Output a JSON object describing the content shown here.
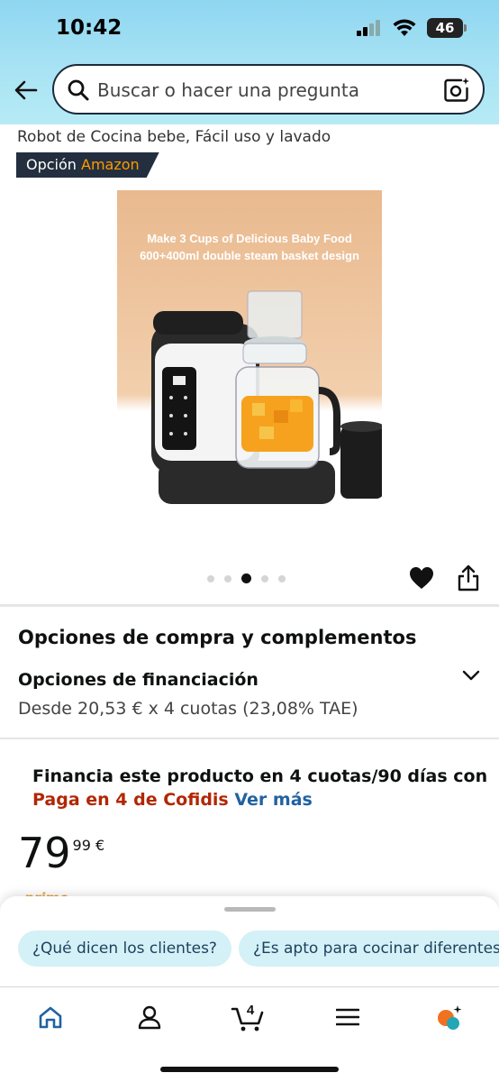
{
  "status_bar": {
    "time": "10:42",
    "battery": "46"
  },
  "search": {
    "placeholder": "Buscar o hacer una pregunta"
  },
  "product": {
    "title": "Robot de Cocina bebe, Fácil uso y lavado",
    "badge_prefix": "Opción",
    "badge_accent": "Amazon",
    "image_caption_line1": "Make 3 Cups of Delicious Baby Food",
    "image_caption_line2": "600+400ml double steam basket design",
    "image_count": 5,
    "image_active_index": 2
  },
  "purchase": {
    "heading": "Opciones de compra y complementos",
    "financing_title": "Opciones de financiación",
    "financing_subtitle": "Desde 20,53 € x 4 cuotas (23,08% TAE)"
  },
  "cofidis": {
    "line1": "Financia este producto en 4 cuotas/90 días con",
    "red_text": "Paga en 4 de Cofidis",
    "link_text": "Ver más"
  },
  "price": {
    "whole": "79",
    "fraction": "99 €",
    "prime_peek": "prime"
  },
  "sheet": {
    "chips": [
      "¿Qué dicen los clientes?",
      "¿Es apto para cocinar diferentes alimentos?"
    ]
  },
  "tabbar": {
    "cart_count": "4"
  },
  "colors": {
    "header_top": "#8fd6f1",
    "badge_bg": "#232f3e",
    "badge_accent": "#ff9900",
    "cofidis_red": "#b12704",
    "link_blue": "#2162a1",
    "chip_bg": "#d3f1f6",
    "nav_active": "#2162a1"
  },
  "icons": [
    "back-arrow-icon",
    "search-icon",
    "camera-search-icon",
    "heart-icon",
    "share-icon",
    "chevron-down-icon",
    "home-icon",
    "account-icon",
    "cart-icon",
    "menu-icon",
    "rufus-assistant-icon"
  ]
}
